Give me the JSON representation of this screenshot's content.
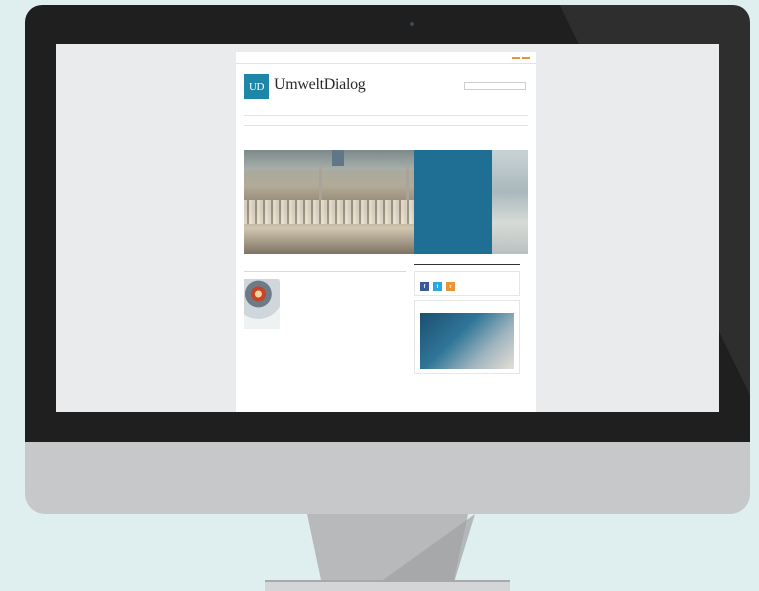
{
  "website": {
    "brand": {
      "logo_mark": "UD",
      "name": "UmweltDialog"
    },
    "nav": {
      "social": {
        "facebook": "f",
        "twitter": "t",
        "rss": "r"
      }
    }
  },
  "colors": {
    "brand_blue": "#1e86a8",
    "panel_blue": "#1e6f93",
    "accent_orange": "#e8953a",
    "bezel": "#1f1f20"
  },
  "icons": [
    "facebook-icon",
    "twitter-icon",
    "rss-icon",
    "camera-icon"
  ]
}
